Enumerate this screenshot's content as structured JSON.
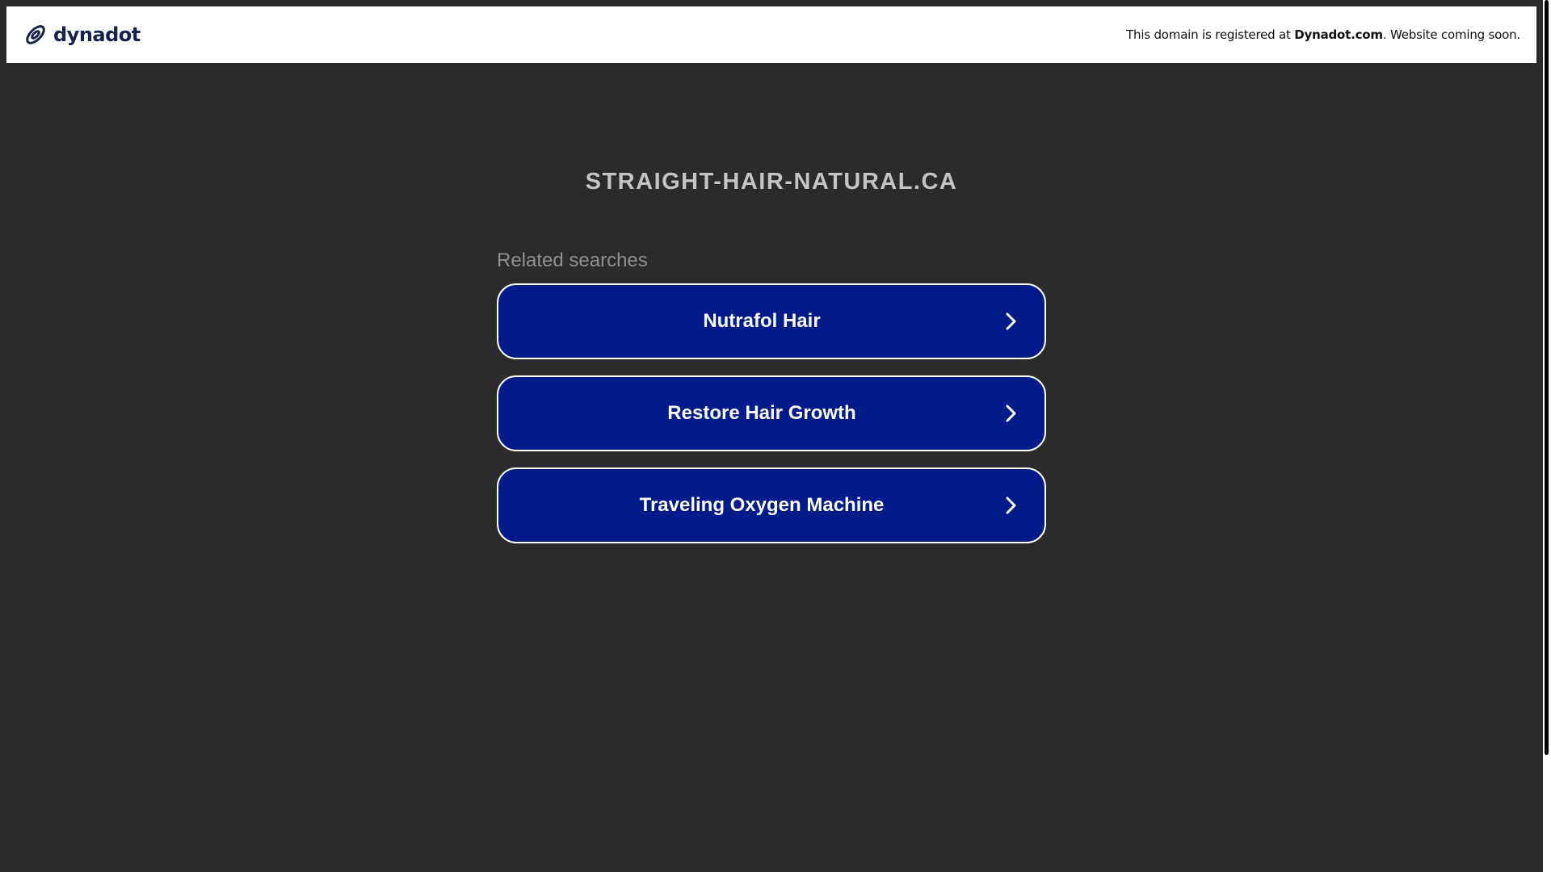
{
  "header": {
    "brand_name": "dynadot",
    "notice_prefix": "This domain is registered at ",
    "notice_link": "Dynadot.com",
    "notice_suffix": ". Website coming soon."
  },
  "main": {
    "domain": "STRAIGHT-HAIR-NATURAL.CA",
    "related_heading": "Related searches",
    "searches": [
      {
        "label": "Nutrafol Hair"
      },
      {
        "label": "Restore Hair Growth"
      },
      {
        "label": "Traveling Oxygen Machine"
      }
    ]
  },
  "colors": {
    "background": "#2b2b2b",
    "header_bg": "#ffffff",
    "button_bg": "#021b8a",
    "button_border": "#ffffff",
    "domain_text": "#c4c4c4",
    "heading_text": "#8f8f8f",
    "brand_text": "#15224a"
  },
  "icons": {
    "brand_logo": "dynadot-logo-icon",
    "button_arrow": "chevron-right-icon"
  }
}
